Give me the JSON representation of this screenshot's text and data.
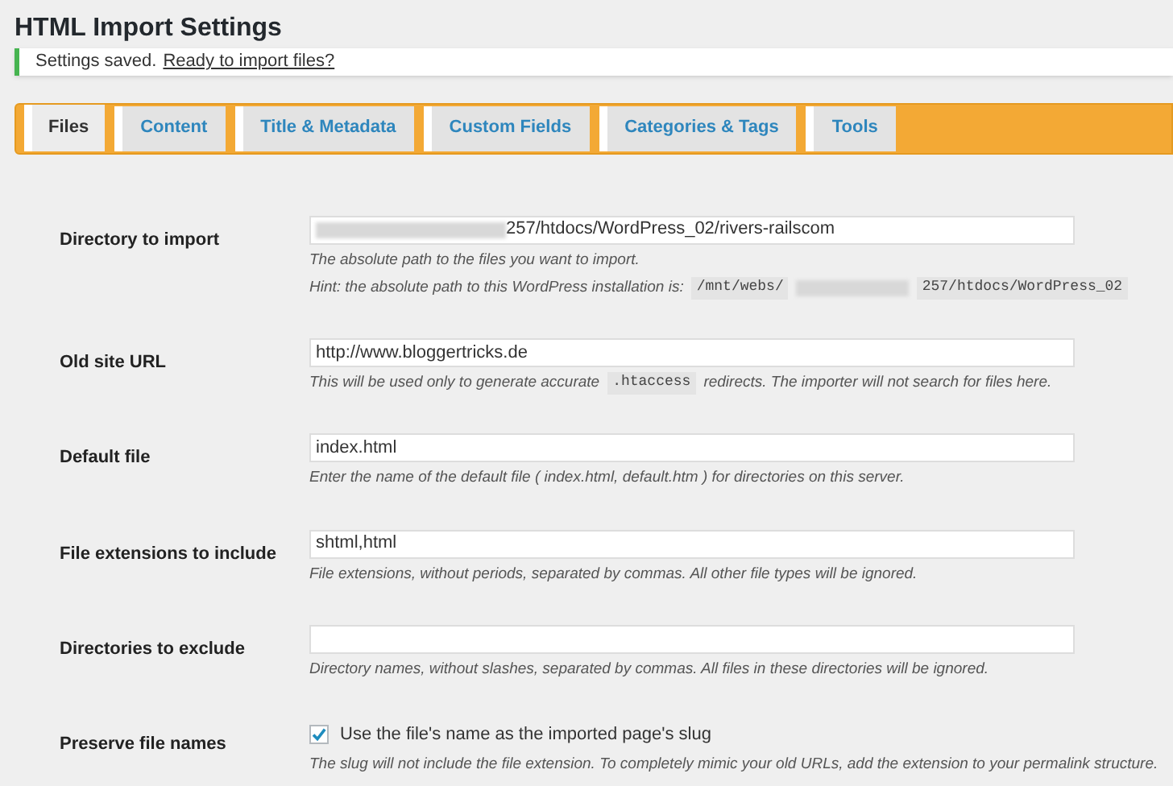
{
  "title": "HTML Import Settings",
  "notice": {
    "text": "Settings saved.",
    "link": "Ready to import files?"
  },
  "tabs": [
    {
      "label": "Files",
      "selected": true
    },
    {
      "label": "Content",
      "selected": false
    },
    {
      "label": "Title & Metadata",
      "selected": false
    },
    {
      "label": "Custom Fields",
      "selected": false
    },
    {
      "label": "Categories & Tags",
      "selected": false
    },
    {
      "label": "Tools",
      "selected": false
    }
  ],
  "fields": [
    {
      "kind": "text",
      "label": "Directory to import",
      "value_redacted": true,
      "value": "257/htdocs/WordPress_02/rivers-railscom",
      "description": [
        [
          {
            "kind": "text",
            "text": "The absolute path to the files you want to import."
          }
        ],
        [
          {
            "kind": "text",
            "text": "Hint: the absolute path to this WordPress installation is:"
          },
          {
            "kind": "code",
            "text": "/mnt/webs/"
          },
          {
            "kind": "redacted"
          },
          {
            "kind": "code",
            "text": "257/htdocs/WordPress_02"
          }
        ]
      ]
    },
    {
      "kind": "text",
      "label": "Old site URL",
      "value_redacted": false,
      "value": "http://www.bloggertricks.de",
      "description": [
        [
          {
            "kind": "text",
            "text": "This will be used only to generate accurate"
          },
          {
            "kind": "code",
            "text": ".htaccess"
          },
          {
            "kind": "text",
            "text": "redirects. The importer will not search for files here."
          }
        ]
      ]
    },
    {
      "kind": "text",
      "label": "Default file",
      "value_redacted": false,
      "value": "index.html",
      "description": [
        [
          {
            "kind": "text",
            "text": "Enter the name of the default file ( index.html, default.htm ) for directories on this server."
          }
        ]
      ]
    },
    {
      "kind": "text",
      "label": "File extensions to include",
      "value_redacted": false,
      "value": "shtml,html",
      "description": [
        [
          {
            "kind": "text",
            "text": "File extensions, without periods, separated by commas. All other file types will be ignored."
          }
        ]
      ]
    },
    {
      "kind": "text",
      "label": "Directories to exclude",
      "value_redacted": false,
      "description": [
        [
          {
            "kind": "text",
            "text": "Directory names, without slashes, separated by commas. All files in these directories will be ignored."
          }
        ]
      ]
    },
    {
      "kind": "checkbox",
      "label": "Preserve file names",
      "checked": true,
      "option": "Use the file's name as the imported page's slug",
      "description": [
        [
          {
            "kind": "text",
            "text": "The slug will not include the file extension. To completely mimic your old URLs, add the extension to your permalink structure."
          }
        ]
      ]
    }
  ]
}
